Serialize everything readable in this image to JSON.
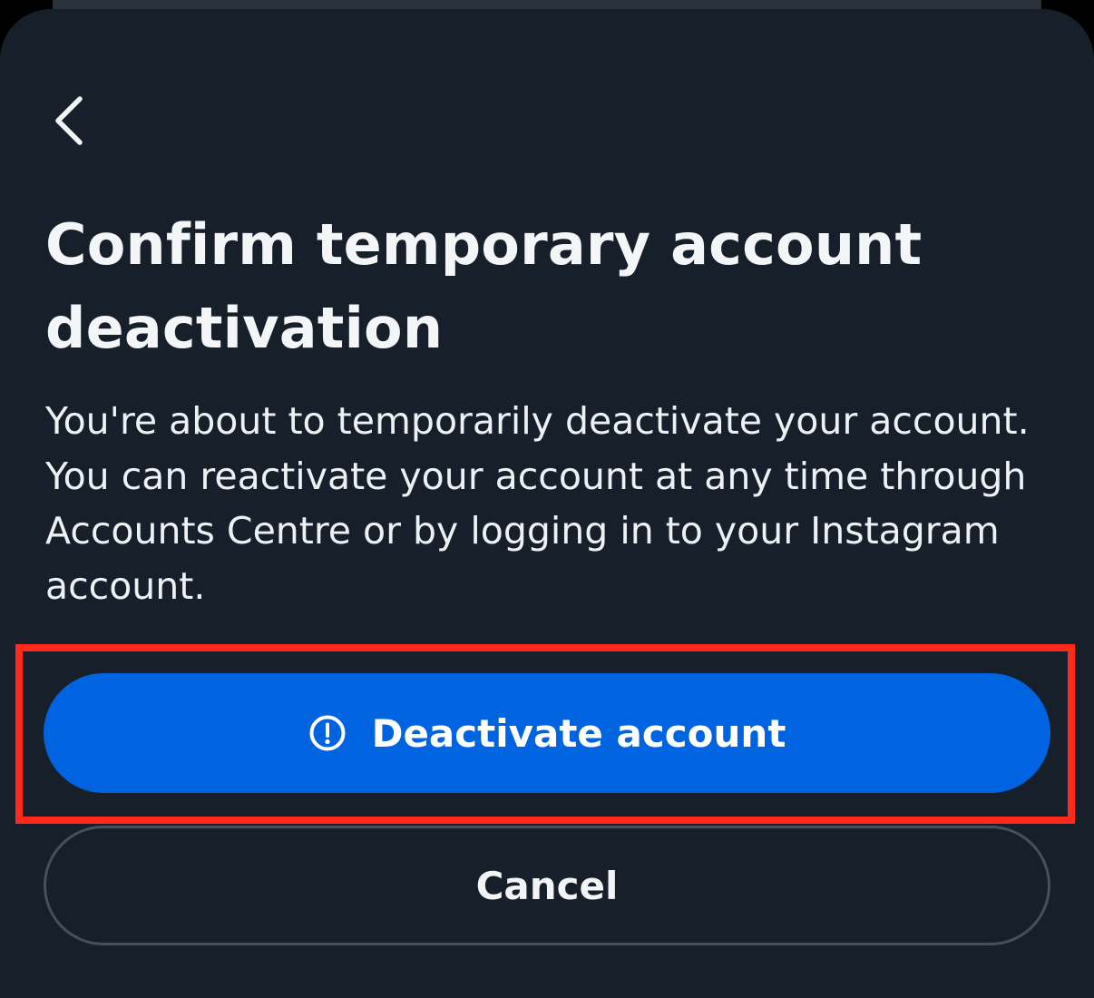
{
  "dialog": {
    "title": "Confirm temporary account deactivation",
    "description": "You're about to temporarily deactivate your account. You can reactivate your account at any time through Accounts Centre or by logging in to your Instagram account."
  },
  "actions": {
    "deactivate_label": "Deactivate account",
    "cancel_label": "Cancel"
  },
  "icons": {
    "back": "chevron-left-icon",
    "deactivate": "alert-circle-icon"
  },
  "colors": {
    "background": "#17202a",
    "primary_button": "#0064e0",
    "highlight": "#ff2a1a"
  }
}
